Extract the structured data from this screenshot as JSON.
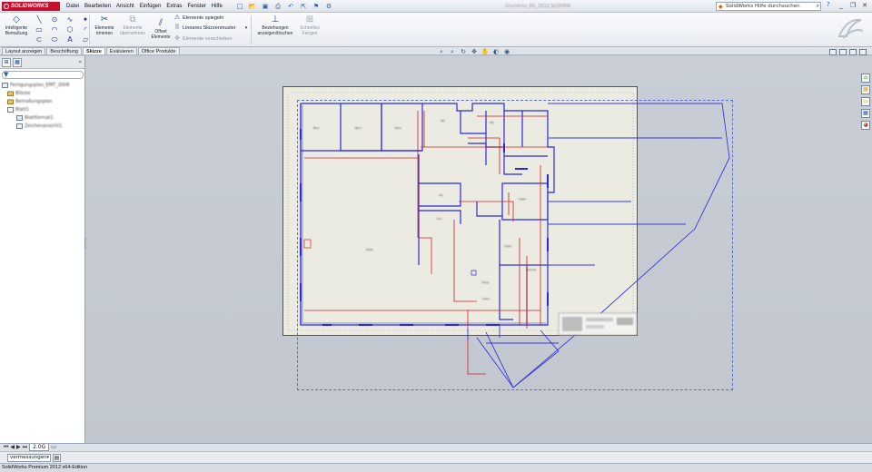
{
  "app": {
    "logo": "SOLIDWORKS",
    "document_title_blurred": "Grundriss_EG_2012.SLDDRW",
    "window_controls": [
      "_",
      "❐",
      "✕"
    ]
  },
  "menu": [
    "Datei",
    "Bearbeiten",
    "Ansicht",
    "Einfügen",
    "Extras",
    "Fenster",
    "Hilfe"
  ],
  "quick_access": [
    "new-icon",
    "open-icon",
    "save-icon",
    "print-icon",
    "undo-icon",
    "select-icon",
    "rebuild-icon",
    "options-icon"
  ],
  "search": {
    "placeholder": "SolidWorks Hilfe durchsuchen"
  },
  "ribbon": {
    "smart_dimension": {
      "line1": "Intelligente",
      "line2": "Bemaßung"
    },
    "trim": {
      "line1": "Elemente",
      "line2": "trimmen"
    },
    "convert": {
      "line1": "Elemente",
      "line2": "übernehmen"
    },
    "offset": {
      "line1": "Offset",
      "line2": "Elemente"
    },
    "mirror": "Elemente spiegeln",
    "linear_pattern": "Lineares Skizzenmuster",
    "move": "Elemente verschieben",
    "relations": {
      "line1": "Beziehungen",
      "line2": "anzeigen/löschen"
    },
    "quick_snaps": {
      "line1": "Schnelles",
      "line2": "Fangen"
    }
  },
  "tabs": [
    {
      "label": "Layout anzeigen",
      "active": false
    },
    {
      "label": "Beschriftung",
      "active": false
    },
    {
      "label": "Skizze",
      "active": true
    },
    {
      "label": "Evaluieren",
      "active": false
    },
    {
      "label": "Office Produkte",
      "active": false
    }
  ],
  "tree": {
    "items": [
      {
        "label": "Fertigungsplan_EMT_3008",
        "indent": 0
      },
      {
        "label": "Blöcke",
        "indent": 1
      },
      {
        "label": "Bemaßungsplan",
        "indent": 1
      },
      {
        "label": "Blatt1",
        "indent": 1
      },
      {
        "label": "Blattformat1",
        "indent": 2
      },
      {
        "label": "Zeichenansicht1",
        "indent": 2
      }
    ]
  },
  "sheet": {
    "tab_label": "2.0G",
    "room_labels": [
      "Büro",
      "Büro",
      "Büro",
      "WC",
      "WC",
      "Flur",
      "Lager",
      "WC",
      "Halle",
      "Technik",
      "Lager",
      "Gang",
      "Labor"
    ]
  },
  "layer": {
    "selected": "vermessungen"
  },
  "status": "SolidWorks Premium 2012 x64-Edition",
  "colors": {
    "sketch_blue": "#2a2ad8",
    "sketch_red": "#d02020",
    "sheet_bg": "#ecebe2",
    "graphics_bg": "#c4c9d1",
    "logo_red": "#c8102e"
  }
}
